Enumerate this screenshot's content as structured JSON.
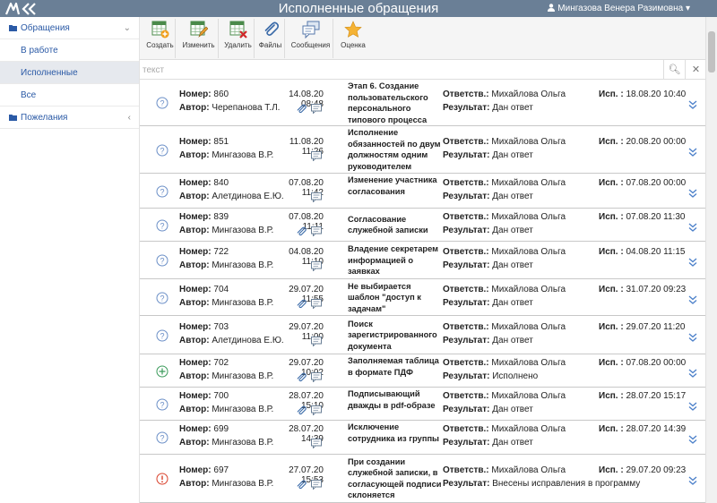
{
  "header": {
    "title": "Исполненные обращения",
    "user": "Мингазова Венера Разимовна"
  },
  "sidebar": {
    "items": [
      {
        "label": "Обращения",
        "level": "top",
        "active": false,
        "chevron": "⌄"
      },
      {
        "label": "В работе",
        "level": "sub",
        "active": false,
        "chevron": ""
      },
      {
        "label": "Исполненные",
        "level": "sub",
        "active": true,
        "chevron": ""
      },
      {
        "label": "Все",
        "level": "sub",
        "active": false,
        "chevron": ""
      },
      {
        "label": "Пожелания",
        "level": "top",
        "active": false,
        "chevron": "‹"
      }
    ]
  },
  "toolbar": {
    "create": "Создать",
    "edit": "Изменить",
    "delete": "Удалить",
    "files": "Файлы",
    "messages": "Сообщения",
    "rating": "Оценка"
  },
  "search": {
    "placeholder": "текст",
    "search_icon": "search-icon",
    "clear_icon": "close-icon"
  },
  "labels": {
    "number": "Номер:",
    "author": "Автор:",
    "responsible": "Ответств.:",
    "result": "Результат:",
    "exec": "Исп. :"
  },
  "colors": {
    "header": "#6a7f96",
    "link": "#2b5aa6",
    "question_icon": "#6b8fc7",
    "plus_icon": "#3a9a5a",
    "alert_icon": "#d9412b"
  },
  "rows": [
    {
      "icon": "question",
      "number": "860",
      "date": "14.08.20 08:48",
      "author": "Черепанова Т.Л.",
      "attach": true,
      "subject": "Этап 6. Создание пользовательского персонального типового процесса",
      "responsible": "Михайлова Ольга",
      "result": "Дан ответ",
      "exec": "18.08.20 10:40"
    },
    {
      "icon": "question",
      "number": "851",
      "date": "11.08.20 11:26",
      "author": "Мингазова В.Р.",
      "attach": false,
      "subject": "Исполнение обязанностей по двум должностям одним руководителем",
      "responsible": "Михайлова Ольга",
      "result": "Дан ответ",
      "exec": "20.08.20 00:00"
    },
    {
      "icon": "question",
      "number": "840",
      "date": "07.08.20 11:42",
      "author": "Алетдинова Е.Ю.",
      "attach": false,
      "subject": "Изменение участника согласования",
      "responsible": "Михайлова Ольга",
      "result": "Дан ответ",
      "exec": "07.08.20 00:00"
    },
    {
      "icon": "question",
      "number": "839",
      "date": "07.08.20 11:11",
      "author": "Мингазова В.Р.",
      "attach": true,
      "subject": "Согласование служебной записки",
      "responsible": "Михайлова Ольга",
      "result": "Дан ответ",
      "exec": "07.08.20 11:30"
    },
    {
      "icon": "question",
      "number": "722",
      "date": "04.08.20 11:10",
      "author": "Мингазова В.Р.",
      "attach": false,
      "subject": "Владение секретарем информацией о заявках",
      "responsible": "Михайлова Ольга",
      "result": "Дан ответ",
      "exec": "04.08.20 11:15"
    },
    {
      "icon": "question",
      "number": "704",
      "date": "29.07.20 11:55",
      "author": "Мингазова В.Р.",
      "attach": true,
      "subject": "Не выбирается шаблон \"доступ к задачам\"",
      "responsible": "Михайлова Ольга",
      "result": "Дан ответ",
      "exec": "31.07.20 09:23"
    },
    {
      "icon": "question",
      "number": "703",
      "date": "29.07.20 11:00",
      "author": "Алетдинова Е.Ю.",
      "attach": false,
      "subject": "Поиск зарегистрированного документа",
      "responsible": "Михайлова Ольга",
      "result": "Дан ответ",
      "exec": "29.07.20 11:20"
    },
    {
      "icon": "plus",
      "number": "702",
      "date": "29.07.20 10:02",
      "author": "Мингазова В.Р.",
      "attach": true,
      "subject": "Заполняемая таблица в формате ПДФ",
      "responsible": "Михайлова Ольга",
      "result": "Исполнено",
      "exec": "07.08.20 00:00"
    },
    {
      "icon": "question",
      "number": "700",
      "date": "28.07.20 15:10",
      "author": "Мингазова В.Р.",
      "attach": true,
      "subject": "Подписывающий дважды в pdf-образе",
      "responsible": "Михайлова Ольга",
      "result": "Дан ответ",
      "exec": "28.07.20 15:17"
    },
    {
      "icon": "question",
      "number": "699",
      "date": "28.07.20 14:39",
      "author": "Мингазова В.Р.",
      "attach": false,
      "subject": "Исключение сотрудника из группы",
      "responsible": "Михайлова Ольга",
      "result": "Дан ответ",
      "exec": "28.07.20 14:39"
    },
    {
      "icon": "alert",
      "number": "697",
      "date": "27.07.20 15:53",
      "author": "Мингазова В.Р.",
      "attach": true,
      "subject": "При создании служебной записки, в согласующей подписи склоняется",
      "responsible": "Михайлова Ольга",
      "result": "Внесены исправления в программу",
      "exec": "29.07.20 09:23"
    }
  ]
}
